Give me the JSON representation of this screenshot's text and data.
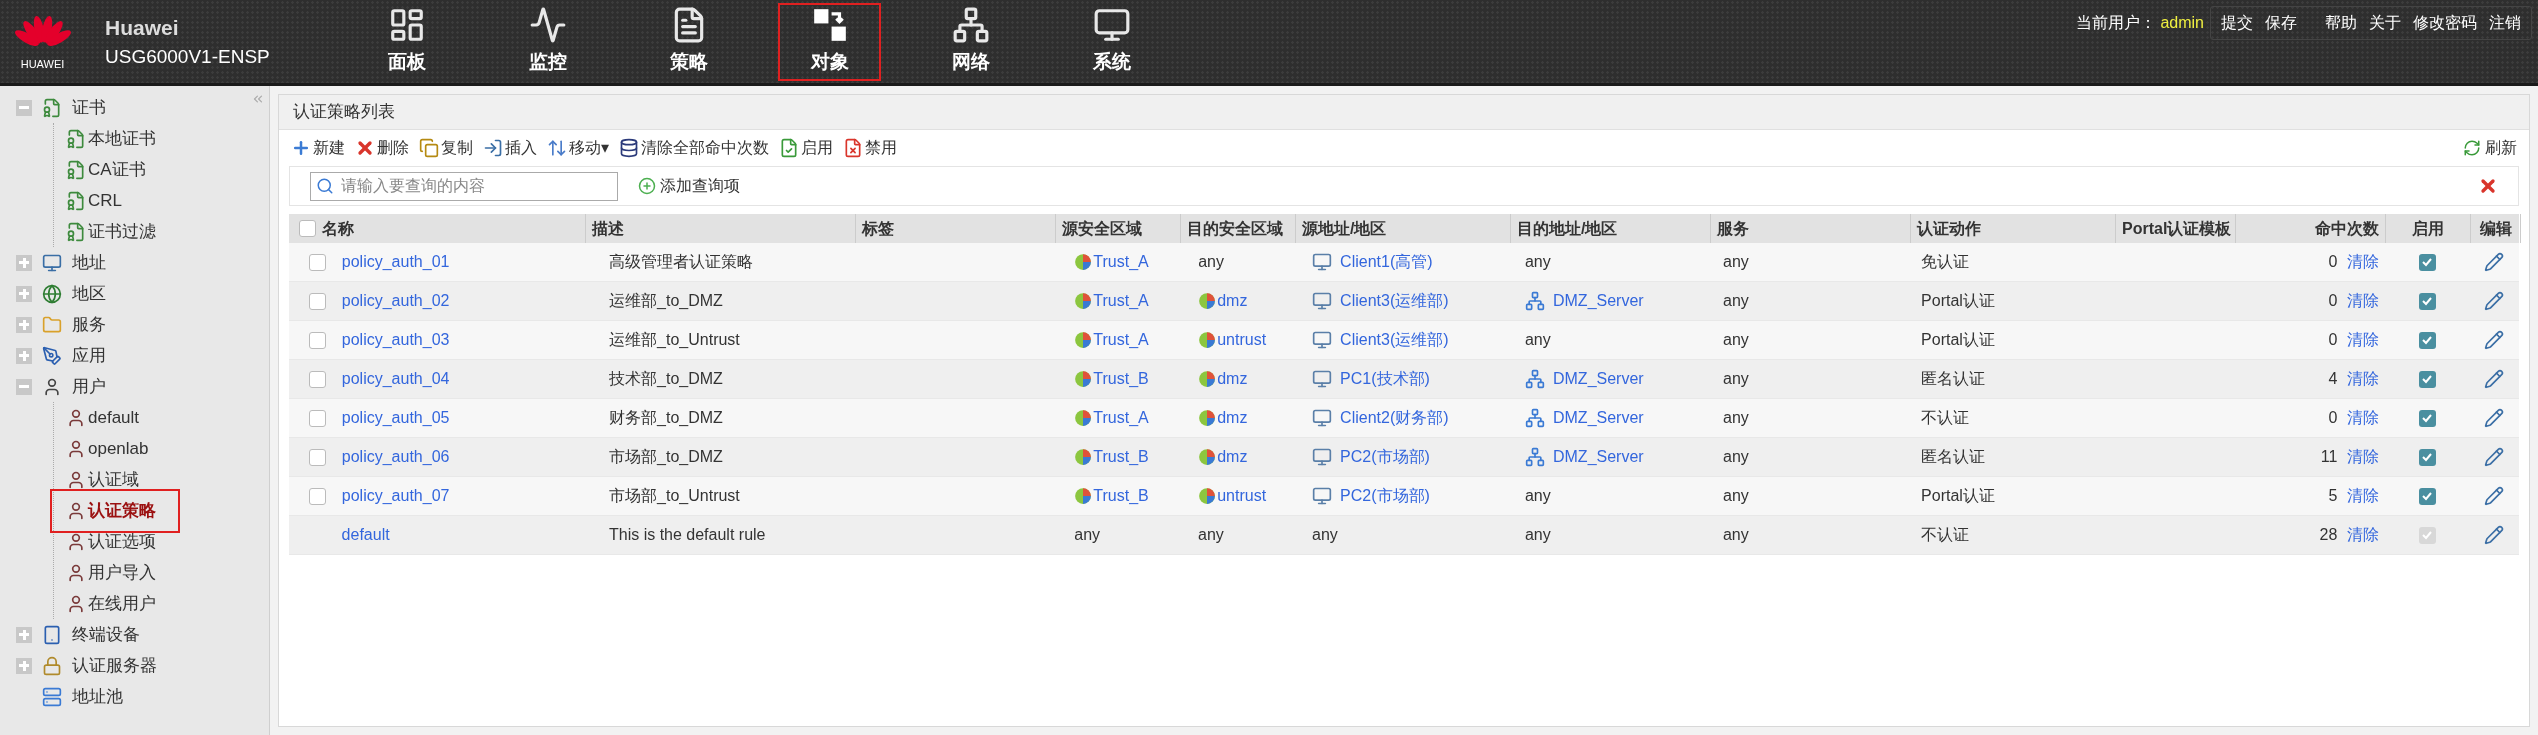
{
  "header": {
    "logo_text": "HUAWEI",
    "product": "Huawei",
    "model": "USG6000V1-ENSP",
    "nav": [
      {
        "kind": "dashboard",
        "label": "面板",
        "selected": false
      },
      {
        "kind": "monitor",
        "label": "监控",
        "selected": false
      },
      {
        "kind": "policy",
        "label": "策略",
        "selected": false
      },
      {
        "kind": "object",
        "label": "对象",
        "selected": true
      },
      {
        "kind": "network",
        "label": "网络",
        "selected": false
      },
      {
        "kind": "system",
        "label": "系统",
        "selected": false
      }
    ],
    "user_label": "当前用户：",
    "user": "admin",
    "links": [
      "提交",
      "保存",
      "帮助",
      "关于",
      "修改密码",
      "注销"
    ]
  },
  "sidebar": {
    "items": [
      {
        "label": "证书",
        "expanded": true,
        "children": [
          {
            "label": "本地证书",
            "selected": false
          },
          {
            "label": "CA证书",
            "selected": false
          },
          {
            "label": "CRL",
            "selected": false
          },
          {
            "label": "证书过滤",
            "selected": false
          }
        ]
      },
      {
        "label": "地址",
        "expanded": false
      },
      {
        "label": "地区",
        "expanded": false
      },
      {
        "label": "服务",
        "expanded": false
      },
      {
        "label": "应用",
        "expanded": false
      },
      {
        "label": "用户",
        "expanded": true,
        "children": [
          {
            "label": "default",
            "selected": false
          },
          {
            "label": "openlab",
            "selected": false
          },
          {
            "label": "认证域",
            "selected": false
          },
          {
            "label": "认证策略",
            "selected": true
          },
          {
            "label": "认证选项",
            "selected": false
          },
          {
            "label": "用户导入",
            "selected": false
          },
          {
            "label": "在线用户",
            "selected": false
          }
        ]
      },
      {
        "label": "终端设备",
        "expanded": false
      },
      {
        "label": "认证服务器",
        "expanded": false
      },
      {
        "label": "地址池"
      }
    ]
  },
  "panel": {
    "title": "认证策略列表",
    "toolbar": [
      {
        "kind": "add",
        "label": "新建"
      },
      {
        "kind": "delete",
        "label": "删除"
      },
      {
        "kind": "copy",
        "label": "复制"
      },
      {
        "kind": "insert",
        "label": "插入"
      },
      {
        "kind": "move",
        "label": "移动▾"
      },
      {
        "kind": "clear",
        "label": "清除全部命中次数"
      },
      {
        "kind": "enable",
        "label": "启用"
      },
      {
        "kind": "disable",
        "label": "禁用"
      }
    ],
    "refresh": "刷新",
    "search_placeholder": "请输入要查询的内容",
    "add_query": "添加查询项",
    "table": {
      "all_checked": false,
      "columns": [
        "名称",
        "描述",
        "标签",
        "源安全区域",
        "目的安全区域",
        "源地址/地区",
        "目的地址/地区",
        "服务",
        "认证动作",
        "Portal认证模板",
        "命中次数",
        "启用",
        "编辑"
      ],
      "rows": [
        {
          "kind": "rule",
          "checked": false,
          "name": "policy_auth_01",
          "description": "高级管理者认证策略",
          "src_zone": {
            "kind": "zone",
            "text": "Trust_A"
          },
          "dst_zone": {
            "kind": "plain",
            "text": "any"
          },
          "src_addr": {
            "kind": "host",
            "text": "Client1(高管)"
          },
          "dst_addr": {
            "kind": "plain",
            "text": "any"
          },
          "service": "any",
          "action": "免认证",
          "hits": "0",
          "clear": "清除",
          "enabled": true,
          "disabled": false
        },
        {
          "kind": "rule",
          "checked": false,
          "name": "policy_auth_02",
          "description": "运维部_to_DMZ",
          "src_zone": {
            "kind": "zone",
            "text": "Trust_A"
          },
          "dst_zone": {
            "kind": "zone",
            "text": "dmz"
          },
          "src_addr": {
            "kind": "host",
            "text": "Client3(运维部)"
          },
          "dst_addr": {
            "kind": "server",
            "text": "DMZ_Server"
          },
          "service": "any",
          "action": "Portal认证",
          "hits": "0",
          "clear": "清除",
          "enabled": true,
          "disabled": false
        },
        {
          "kind": "rule",
          "checked": false,
          "name": "policy_auth_03",
          "description": "运维部_to_Untrust",
          "src_zone": {
            "kind": "zone",
            "text": "Trust_A"
          },
          "dst_zone": {
            "kind": "zone",
            "text": "untrust"
          },
          "src_addr": {
            "kind": "host",
            "text": "Client3(运维部)"
          },
          "dst_addr": {
            "kind": "plain",
            "text": "any"
          },
          "service": "any",
          "action": "Portal认证",
          "hits": "0",
          "clear": "清除",
          "enabled": true,
          "disabled": false
        },
        {
          "kind": "rule",
          "checked": false,
          "name": "policy_auth_04",
          "description": "技术部_to_DMZ",
          "src_zone": {
            "kind": "zone",
            "text": "Trust_B"
          },
          "dst_zone": {
            "kind": "zone",
            "text": "dmz"
          },
          "src_addr": {
            "kind": "host",
            "text": "PC1(技术部)"
          },
          "dst_addr": {
            "kind": "server",
            "text": "DMZ_Server"
          },
          "service": "any",
          "action": "匿名认证",
          "hits": "4",
          "clear": "清除",
          "enabled": true,
          "disabled": false
        },
        {
          "kind": "rule",
          "checked": false,
          "name": "policy_auth_05",
          "description": "财务部_to_DMZ",
          "src_zone": {
            "kind": "zone",
            "text": "Trust_A"
          },
          "dst_zone": {
            "kind": "zone",
            "text": "dmz"
          },
          "src_addr": {
            "kind": "host",
            "text": "Client2(财务部)"
          },
          "dst_addr": {
            "kind": "server",
            "text": "DMZ_Server"
          },
          "service": "any",
          "action": "不认证",
          "hits": "0",
          "clear": "清除",
          "enabled": true,
          "disabled": false
        },
        {
          "kind": "rule",
          "checked": false,
          "name": "policy_auth_06",
          "description": "市场部_to_DMZ",
          "src_zone": {
            "kind": "zone",
            "text": "Trust_B"
          },
          "dst_zone": {
            "kind": "zone",
            "text": "dmz"
          },
          "src_addr": {
            "kind": "host",
            "text": "PC2(市场部)"
          },
          "dst_addr": {
            "kind": "server",
            "text": "DMZ_Server"
          },
          "service": "any",
          "action": "匿名认证",
          "hits": "11",
          "clear": "清除",
          "enabled": true,
          "disabled": false
        },
        {
          "kind": "rule",
          "checked": false,
          "name": "policy_auth_07",
          "description": "市场部_to_Untrust",
          "src_zone": {
            "kind": "zone",
            "text": "Trust_B"
          },
          "dst_zone": {
            "kind": "zone",
            "text": "untrust"
          },
          "src_addr": {
            "kind": "host",
            "text": "PC2(市场部)"
          },
          "dst_addr": {
            "kind": "plain",
            "text": "any"
          },
          "service": "any",
          "action": "Portal认证",
          "hits": "5",
          "clear": "清除",
          "enabled": true,
          "disabled": false
        },
        {
          "kind": "default",
          "name": "default",
          "description": "This is the default rule",
          "src_zone": {
            "kind": "plain",
            "text": "any"
          },
          "dst_zone": {
            "kind": "plain",
            "text": "any"
          },
          "src_addr": {
            "kind": "plain",
            "text": "any"
          },
          "dst_addr": {
            "kind": "plain",
            "text": "any"
          },
          "service": "any",
          "action": "不认证",
          "hits": "28",
          "clear": "清除",
          "enabled": true,
          "disabled": true
        }
      ]
    }
  }
}
